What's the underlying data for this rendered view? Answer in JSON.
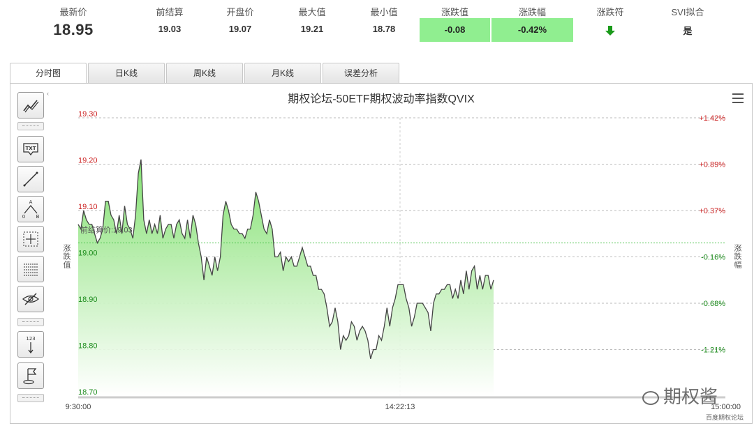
{
  "stats": [
    {
      "label": "最新价",
      "value": "18.95"
    },
    {
      "label": "前结算",
      "value": "19.03"
    },
    {
      "label": "开盘价",
      "value": "19.07"
    },
    {
      "label": "最大值",
      "value": "19.21"
    },
    {
      "label": "最小值",
      "value": "18.78"
    },
    {
      "label": "涨跌值",
      "value": "-0.08"
    },
    {
      "label": "涨跌幅",
      "value": "-0.42%"
    },
    {
      "label": "涨跌符",
      "value": "down-arrow-icon"
    },
    {
      "label": "SVI拟合",
      "value": "是"
    }
  ],
  "colors": {
    "accent_green": "#90ee90",
    "down_arrow": "#1a9a1a",
    "axis_red": "#cc2222",
    "axis_green": "#1a8a1a",
    "line": "#444444"
  },
  "tabs": [
    {
      "label": "分时图",
      "active": true
    },
    {
      "label": "日K线",
      "active": false
    },
    {
      "label": "周K线",
      "active": false
    },
    {
      "label": "月K线",
      "active": false
    },
    {
      "label": "误差分析",
      "active": false
    }
  ],
  "toolbar": [
    "trend-lines-icon",
    "text-label-icon",
    "line-draw-icon",
    "abc-pattern-icon",
    "crosshair-icon",
    "grid-icon",
    "hide-eye-icon",
    "price-scale-icon",
    "flag-icon"
  ],
  "watermark_text": "期权酱",
  "site_text": "百度期权论坛",
  "chart_data": {
    "type": "area",
    "title": "期权论坛-50ETF期权波动率指数QVIX",
    "ylabel": "涨跌值",
    "ylabel_right": "涨跌幅",
    "ylim": [
      18.7,
      19.3
    ],
    "yticks": [
      "19.30",
      "19.20",
      "19.10",
      "19.00",
      "18.90",
      "18.80",
      "18.70"
    ],
    "right_ticks": [
      "+1.42%",
      "+0.89%",
      "+0.37%",
      "-0.16%",
      "-0.68%",
      "-1.21%"
    ],
    "prev_settle": 19.03,
    "prev_settle_label": "前结算价:19.03",
    "x_ticks": [
      "9:30:00",
      "14:22:13",
      "15:00:00"
    ],
    "x_range": [
      "9:30:00",
      "15:00:00"
    ],
    "grid": true,
    "series": [
      {
        "values": [
          19.07,
          19.06,
          19.1,
          19.08,
          19.07,
          19.07,
          19.05,
          19.03,
          19.04,
          19.06,
          19.12,
          19.12,
          19.09,
          19.08,
          19.05,
          19.09,
          19.05,
          19.11,
          19.07,
          19.06,
          19.04,
          19.09,
          19.18,
          19.21,
          19.08,
          19.05,
          19.08,
          19.05,
          19.07,
          19.05,
          19.09,
          19.04,
          19.06,
          19.07,
          19.07,
          19.04,
          19.07,
          19.08,
          19.05,
          19.04,
          19.08,
          19.04,
          19.09,
          19.07,
          19.03,
          19.0,
          18.95,
          19.0,
          18.98,
          18.96,
          19.0,
          18.97,
          19.0,
          19.09,
          19.12,
          19.1,
          19.07,
          19.06,
          19.06,
          19.05,
          19.05,
          19.04,
          19.06,
          19.06,
          19.09,
          19.14,
          19.12,
          19.09,
          19.06,
          19.05,
          19.08,
          19.06,
          19.0,
          19.0,
          19.01,
          18.97,
          19.0,
          18.99,
          19.0,
          18.98,
          18.98,
          19.0,
          19.02,
          19.0,
          18.98,
          18.98,
          18.96,
          18.96,
          18.93,
          18.93,
          18.92,
          18.89,
          18.85,
          18.86,
          18.89,
          18.86,
          18.8,
          18.83,
          18.82,
          18.83,
          18.86,
          18.85,
          18.82,
          18.84,
          18.85,
          18.84,
          18.82,
          18.78,
          18.8,
          18.8,
          18.83,
          18.82,
          18.85,
          18.89,
          18.85,
          18.89,
          18.91,
          18.94,
          18.94,
          18.94,
          18.91,
          18.89,
          18.85,
          18.87,
          18.9,
          18.9,
          18.9,
          18.89,
          18.88,
          18.84,
          18.9,
          18.92,
          18.92,
          18.93,
          18.93,
          18.94,
          18.94,
          18.91,
          18.93,
          18.91,
          18.95,
          18.92,
          18.97,
          18.93,
          18.97,
          18.98,
          18.93,
          18.96,
          18.93,
          18.96,
          18.96,
          18.93,
          18.95
        ]
      }
    ]
  }
}
